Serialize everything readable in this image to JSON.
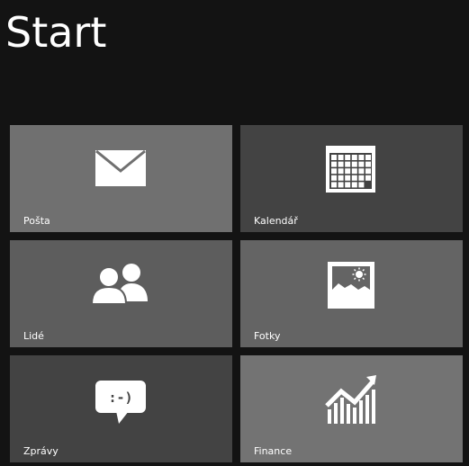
{
  "screen": {
    "title": "Start",
    "background_color": "#131313"
  },
  "tiles": [
    {
      "id": "mail",
      "label": "Pošta",
      "icon": "envelope-icon",
      "color": "#707070"
    },
    {
      "id": "calendar",
      "label": "Kalendář",
      "icon": "calendar-icon",
      "color": "#434343"
    },
    {
      "id": "people",
      "label": "Lidé",
      "icon": "people-icon",
      "color": "#5d5d5d"
    },
    {
      "id": "photos",
      "label": "Fotky",
      "icon": "photo-icon",
      "color": "#646464"
    },
    {
      "id": "messages",
      "label": "Zprávy",
      "icon": "chat-bubble-icon",
      "color": "#434343"
    },
    {
      "id": "finance",
      "label": "Finance",
      "icon": "finance-chart-icon",
      "color": "#737373"
    }
  ],
  "messages_icon_text": ":-)"
}
